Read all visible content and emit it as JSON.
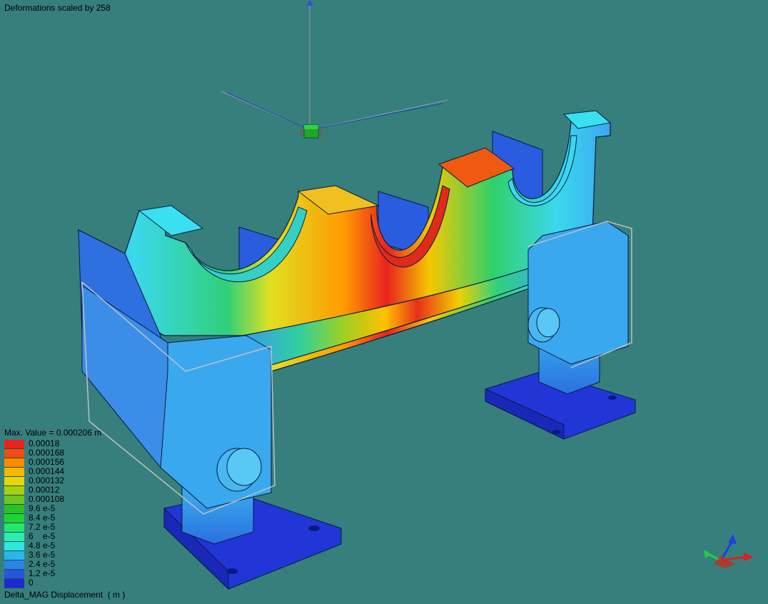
{
  "viewer": {
    "deformation_label": "Deformations scaled by 258",
    "max_value_label": "Max. Value = 0.000206 m",
    "result_label": "Delta_MAG Displacement  ( m )"
  },
  "legend": {
    "items": [
      {
        "label": "0.00018",
        "color": "#e8221f"
      },
      {
        "label": "0.000168",
        "color": "#f24d10"
      },
      {
        "label": "0.000156",
        "color": "#ff8a00"
      },
      {
        "label": "0.000144",
        "color": "#f5b800"
      },
      {
        "label": "0.000132",
        "color": "#e6d800"
      },
      {
        "label": "0.00012",
        "color": "#a8d013"
      },
      {
        "label": "0.000108",
        "color": "#6cc620"
      },
      {
        "label": "9.6 e-5",
        "color": "#28c225"
      },
      {
        "label": "8.4 e-5",
        "color": "#1ed430"
      },
      {
        "label": "7.2 e-5",
        "color": "#23e86c"
      },
      {
        "label": "6    e-5",
        "color": "#28f0b0"
      },
      {
        "label": "4.8 e-5",
        "color": "#2ee8e0"
      },
      {
        "label": "3.6 e-5",
        "color": "#28b8e8"
      },
      {
        "label": "2.4 e-5",
        "color": "#2a86e2"
      },
      {
        "label": "1.2 e-5",
        "color": "#2656da"
      },
      {
        "label": "0",
        "color": "#1e28d6"
      }
    ]
  },
  "colors": {
    "background": "#367f7d",
    "max": "#e8221f",
    "min": "#1e28d6"
  }
}
